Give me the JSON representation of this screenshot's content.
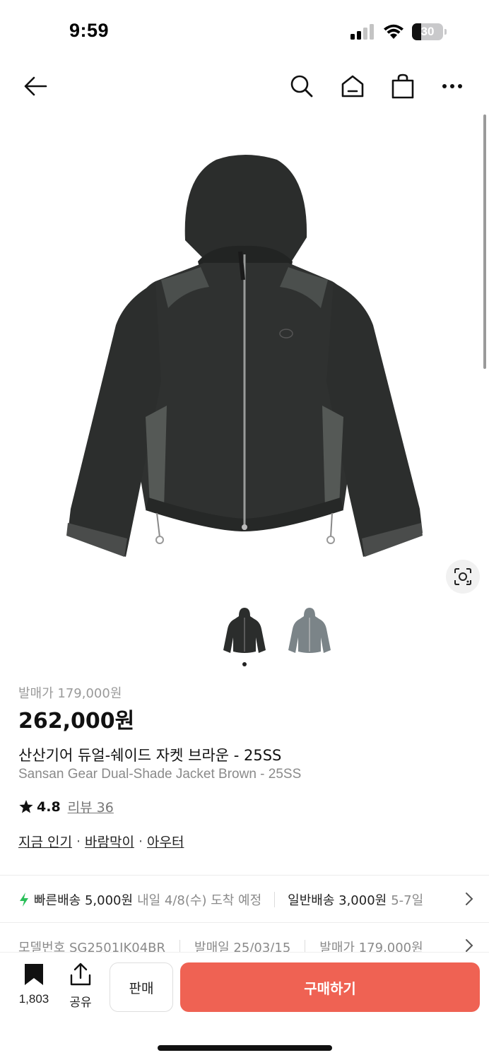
{
  "status_bar": {
    "time": "9:59",
    "battery": "30"
  },
  "nav": {
    "icons": [
      "back-arrow-icon",
      "search-icon",
      "home-icon",
      "shopping-bag-icon",
      "more-icon"
    ]
  },
  "product": {
    "release_price": "발매가 179,000원",
    "price": "262,000원",
    "title_ko": "산산기어 듀얼-쉐이드 자켓 브라운 - 25SS",
    "title_en": "Sansan Gear Dual-Shade Jacket Brown - 25SS",
    "rating": "4.8",
    "review_label": "리뷰 36",
    "tags": [
      "지금 인기",
      "바람막이",
      "아우터"
    ],
    "tag_separator": "·"
  },
  "shipping": {
    "fast_label": "빠른배송 5,000원",
    "fast_eta": "내일 4/8(수) 도착 예정",
    "normal_label": "일반배송 3,000원",
    "normal_eta": "5-7일"
  },
  "details": {
    "model": "모델번호 SG2501JK04BR",
    "release_date": "발매일 25/03/15",
    "release_price": "발매가 179,000원"
  },
  "bottom_bar": {
    "bookmark_count": "1,803",
    "share_label": "공유",
    "sell_label": "판매",
    "buy_label": "구매하기"
  },
  "colors": {
    "accent": "#ef6253",
    "fast_bolt": "#2bbf5a"
  }
}
